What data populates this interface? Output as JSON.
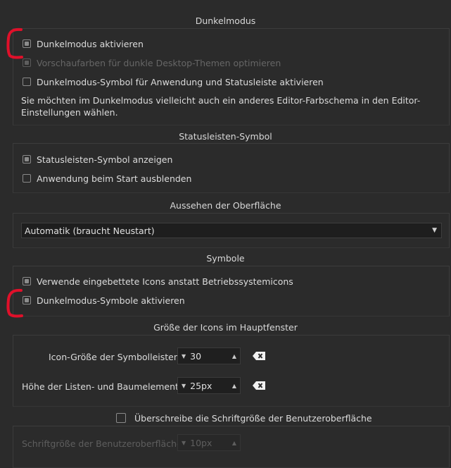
{
  "dark_mode": {
    "title": "Dunkelmodus",
    "enable": "Dunkelmodus aktivieren",
    "optimize_preview": "Vorschaufarben für dunkle Desktop-Themen optimieren",
    "symbol_enable": "Dunkelmodus-Symbol für Anwendung und Statusleiste aktivieren",
    "note": "Sie möchten im Dunkelmodus vielleicht auch ein anderes Editor-Farbschema in den Editor-Einstellungen wählen."
  },
  "statusbar": {
    "title": "Statusleisten-Symbol",
    "show_icon": "Statusleisten-Symbol anzeigen",
    "hide_on_start": "Anwendung beim Start ausblenden"
  },
  "appearance": {
    "title": "Aussehen der Oberfläche",
    "selected": "Automatik (braucht Neustart)"
  },
  "symbols": {
    "title": "Symbole",
    "embedded_icons": "Verwende eingebettete Icons anstatt Betriebssystemicons",
    "dark_symbols": "Dunkelmodus-Symbole aktivieren"
  },
  "icon_size": {
    "title": "Größe der Icons im Hauptfenster",
    "toolbar_label": "Icon-Größe der Symbolleisten:",
    "toolbar_value": "30",
    "list_label": "Höhe der Listen- und Baumelemente:",
    "list_value": "25px"
  },
  "font_override": {
    "title": "Überschreibe die Schriftgröße der Benutzeroberfläche",
    "size_label": "Schriftgröße der Benutzeroberfläche:",
    "size_value": "10px"
  },
  "colors": {
    "background": "#2b2b2b",
    "annotation_red": "#e0102a"
  }
}
